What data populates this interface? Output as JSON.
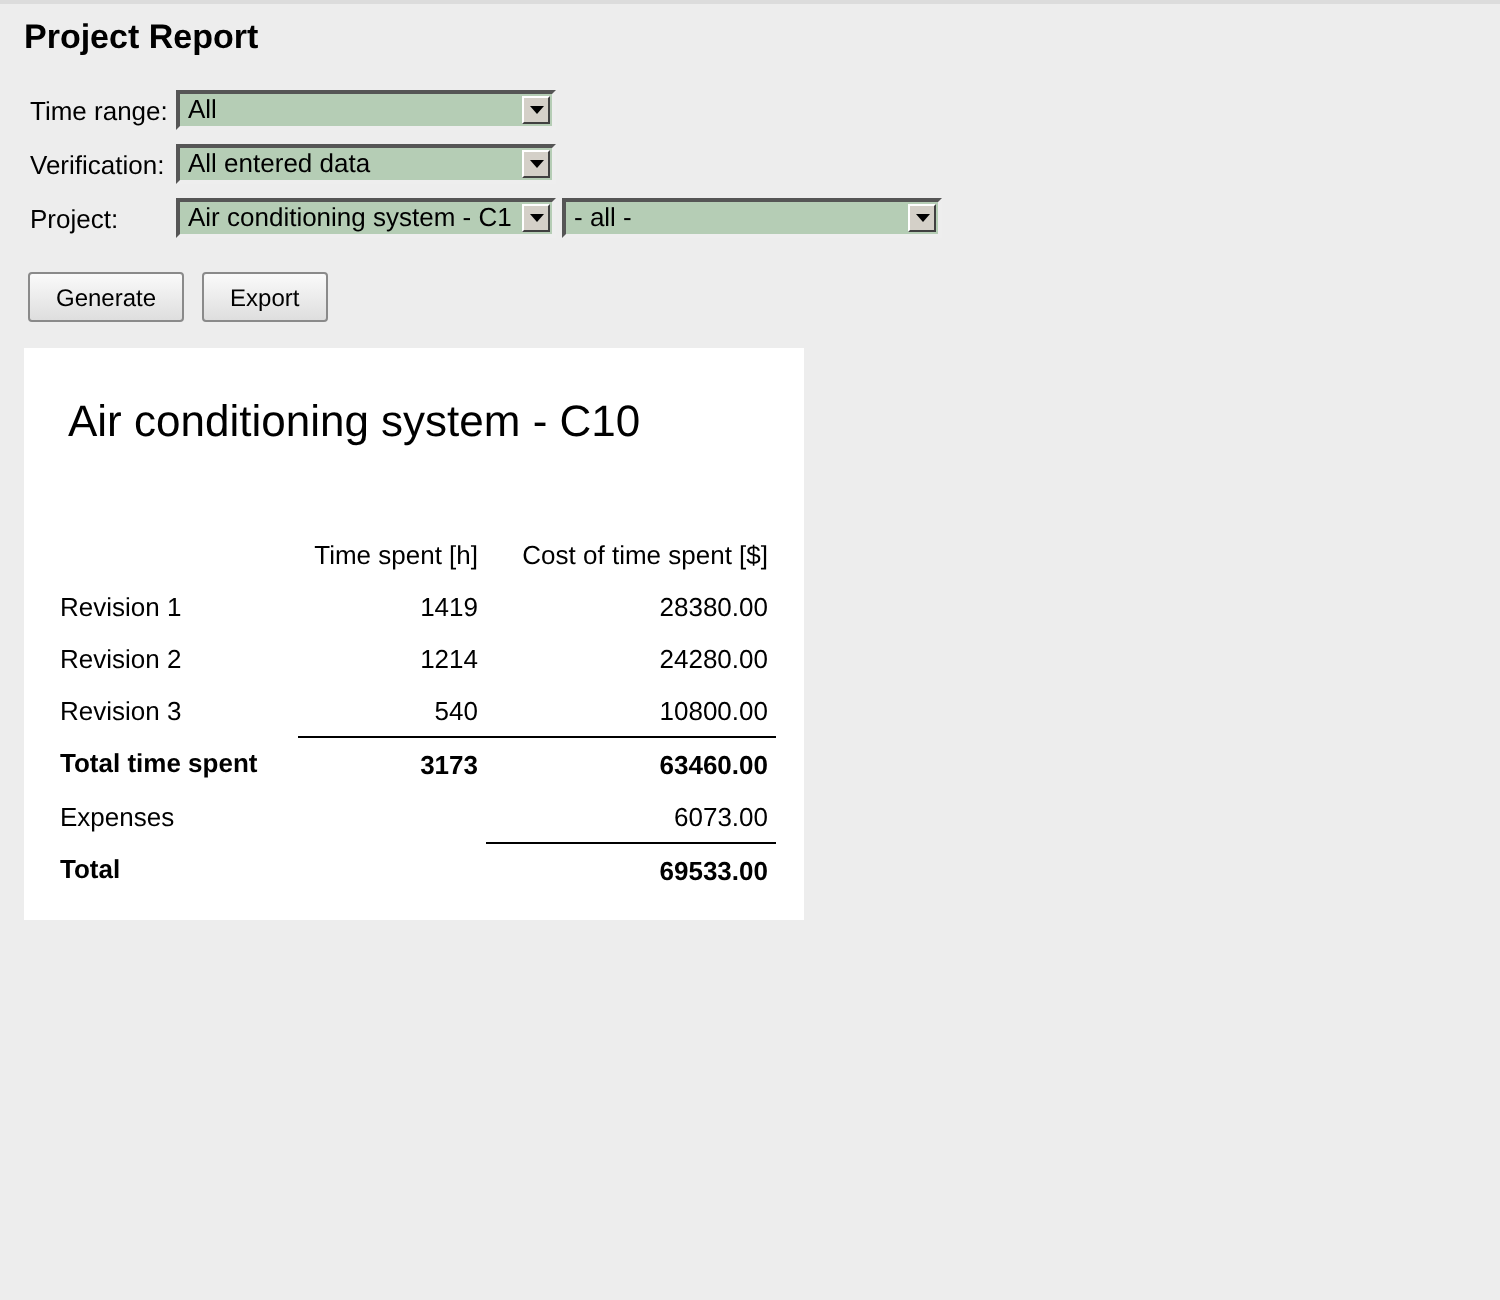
{
  "page_title": "Project Report",
  "filters": [
    {
      "label": "Time range:",
      "selects": [
        "All"
      ]
    },
    {
      "label": "Verification:",
      "selects": [
        "All entered data"
      ]
    },
    {
      "label": "Project:",
      "selects": [
        "Air conditioning system - C1",
        "- all -"
      ]
    }
  ],
  "buttons": [
    "Generate",
    "Export"
  ],
  "report": {
    "title": "Air conditioning system - C10",
    "columns": [
      "Time spent [h]",
      "Cost of time spent [$]"
    ],
    "rows": [
      {
        "kind": "item",
        "label": "Revision 1",
        "time": "1419",
        "cost": "28380.00"
      },
      {
        "kind": "item",
        "label": "Revision 2",
        "time": "1214",
        "cost": "24280.00"
      },
      {
        "kind": "item",
        "label": "Revision 3",
        "time": "540",
        "cost": "10800.00"
      },
      {
        "kind": "subtotal",
        "label": "Total time spent",
        "time": "3173",
        "cost": "63460.00"
      },
      {
        "kind": "item",
        "label": "Expenses",
        "cost": "6073.00"
      },
      {
        "kind": "total",
        "label": "Total",
        "cost": "69533.00"
      }
    ]
  }
}
